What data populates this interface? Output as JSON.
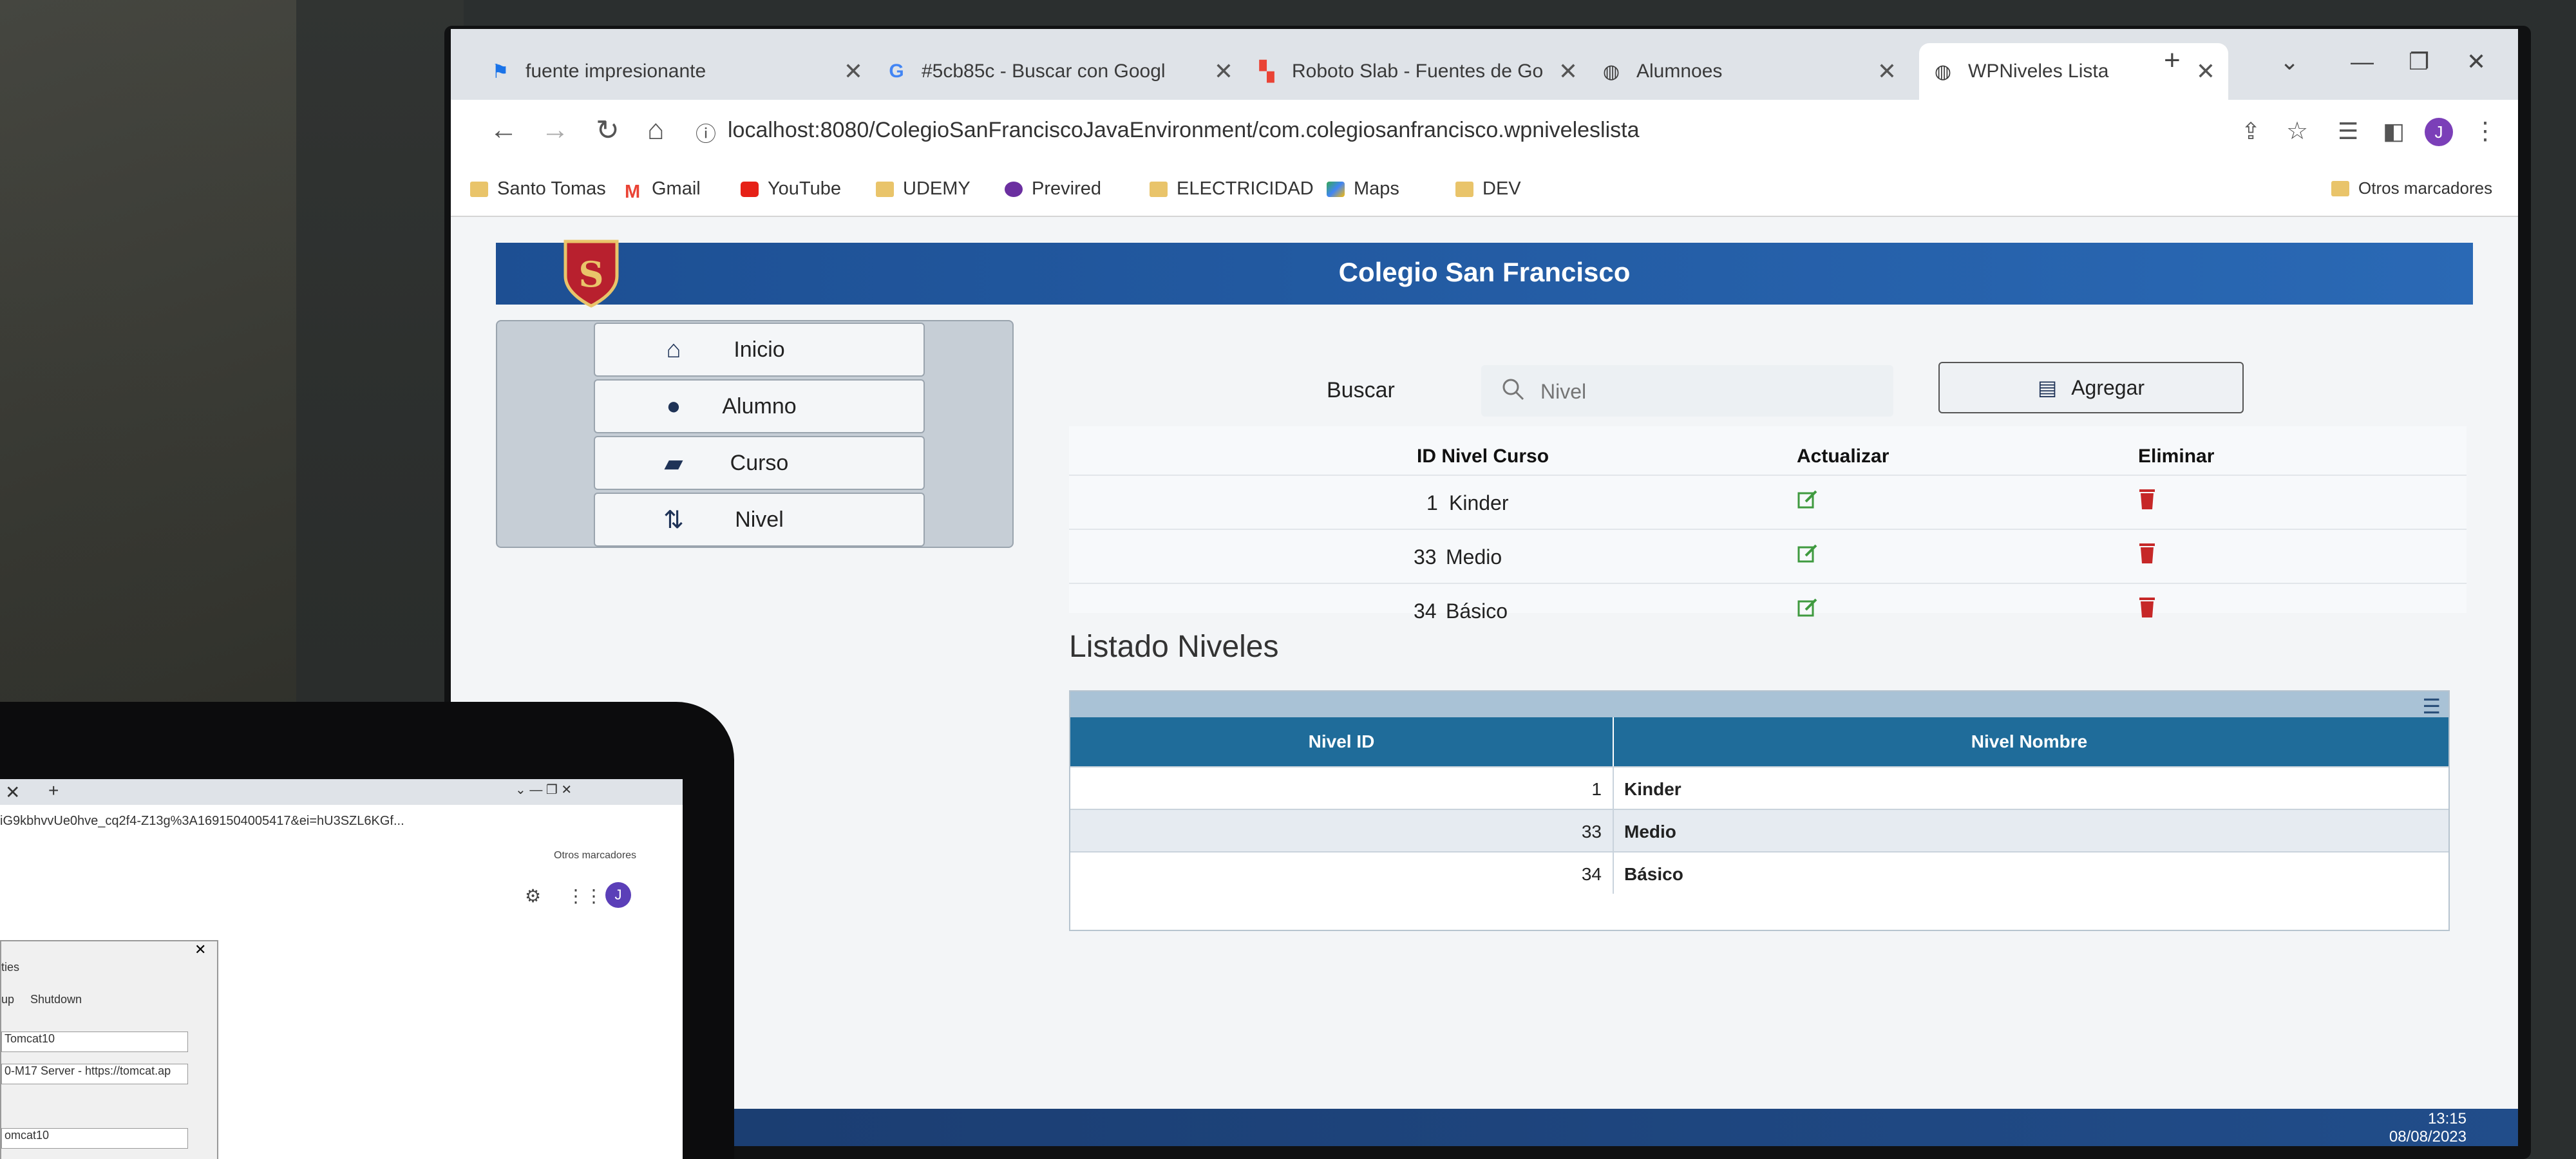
{
  "browser": {
    "tabs": [
      {
        "title": "fuente impresionante",
        "icon": "flag-icon"
      },
      {
        "title": "#5cb85c - Buscar con Googl",
        "icon": "google-icon"
      },
      {
        "title": "Roboto Slab - Fuentes de Go",
        "icon": "fonts-icon"
      },
      {
        "title": "Alumnoes",
        "icon": "globe-icon"
      },
      {
        "title": "WPNiveles Lista",
        "icon": "globe-icon"
      }
    ],
    "url": "localhost:8080/ColegioSanFranciscoJavaEnvironment/com.colegiosanfrancisco.wpniveleslista",
    "bookmarks": [
      "Santo Tomas",
      "Gmail",
      "YouTube",
      "UDEMY",
      "Previred",
      "ELECTRICIDAD",
      "Maps",
      "DEV"
    ],
    "other_bookmarks": "Otros marcadores",
    "profile_initial": "J"
  },
  "app": {
    "title": "Colegio San Francisco",
    "menu": [
      "Inicio",
      "Alumno",
      "Curso",
      "Nivel"
    ],
    "search_label": "Buscar",
    "search_placeholder": "Nivel",
    "add_label": "Agregar",
    "crud_headers": {
      "id_nivel": "ID Nivel Curso",
      "update": "Actualizar",
      "delete": "Eliminar"
    },
    "crud_rows": [
      {
        "id": "1",
        "name": "Kinder"
      },
      {
        "id": "33",
        "name": "Medio"
      },
      {
        "id": "34",
        "name": "Básico"
      }
    ],
    "list_title": "Listado Niveles",
    "grid_headers": {
      "id": "Nivel ID",
      "name": "Nivel Nombre"
    },
    "grid_rows": [
      {
        "id": "1",
        "name": "Kinder"
      },
      {
        "id": "33",
        "name": "Medio"
      },
      {
        "id": "34",
        "name": "Básico"
      }
    ]
  },
  "taskbar": {
    "time": "13:15",
    "date": "08/08/2023"
  },
  "laptop": {
    "url": "iG9kbhvvUe0hve_cq2f4-Z13g%3A1691504005417&ei=hU3SZL6KGf...",
    "other_bookmarks": "Otros marcadores",
    "tab_label": "Shutdown",
    "tab_prefix": "up",
    "title_fragment": "ties",
    "field1": "Tomcat10",
    "field2": "0-M17 Server - https://tomcat.ap",
    "field3": "omcat10"
  }
}
